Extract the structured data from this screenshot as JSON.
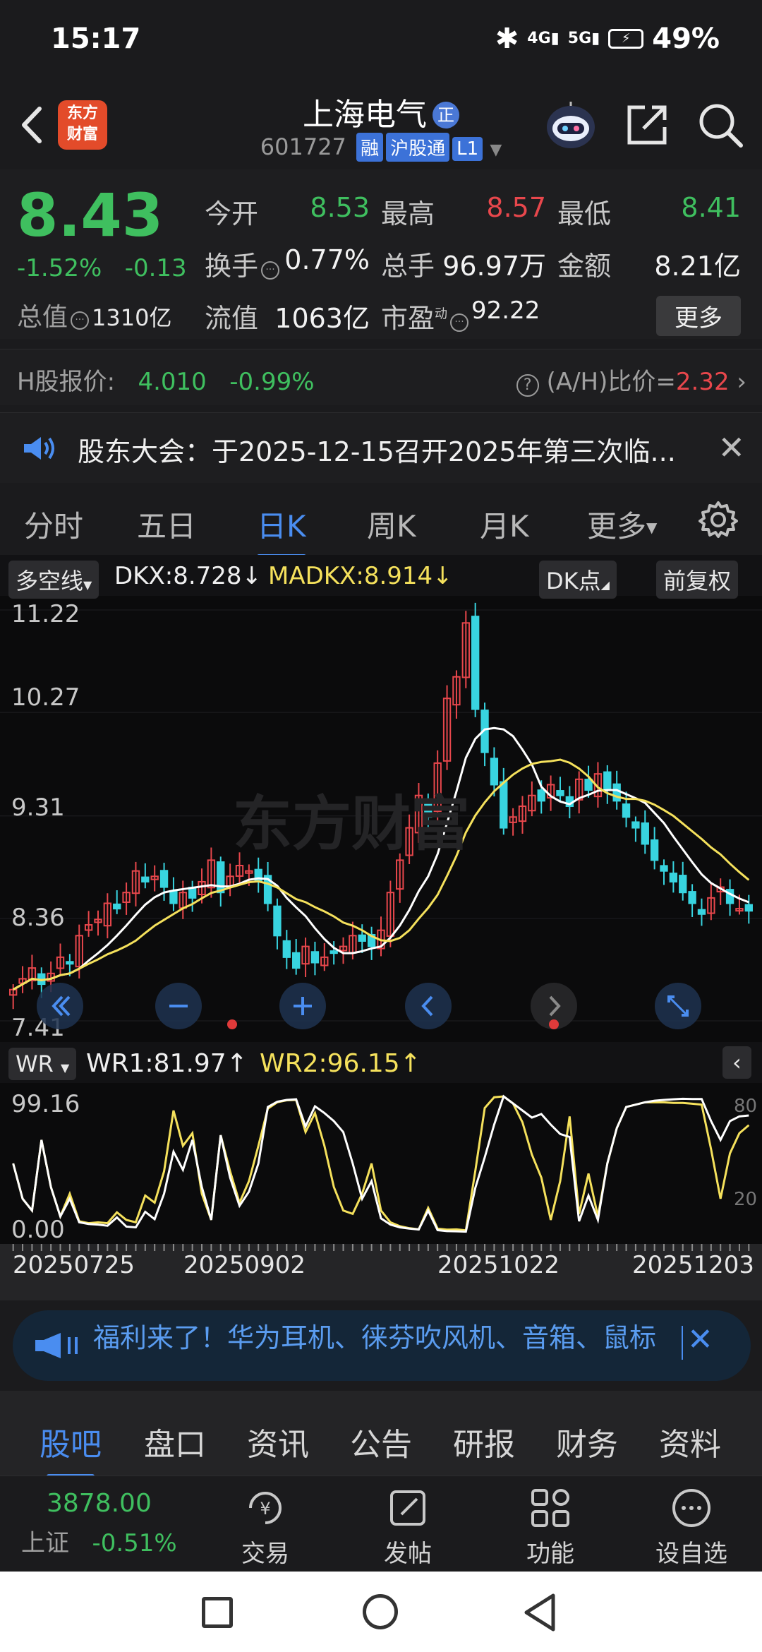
{
  "status": {
    "time": "15:17",
    "net1": "4G",
    "net2": "5G",
    "battery": "49%"
  },
  "header": {
    "brand_line1": "东方",
    "brand_line2": "财富",
    "stock_name": "上海电气",
    "badge": "正",
    "stock_code": "601727",
    "tags": [
      "融",
      "沪股通",
      "L1"
    ]
  },
  "quote": {
    "price": "8.43",
    "change_pct": "-1.52%",
    "change": "-0.13",
    "rows": [
      [
        {
          "label": "今开",
          "value": "8.53",
          "color": "green"
        },
        {
          "label": "最高",
          "value": "8.57",
          "color": "red"
        },
        {
          "label": "最低",
          "value": "8.41",
          "color": "green"
        }
      ],
      [
        {
          "label": "换手",
          "value": "0.77%",
          "color": "white"
        },
        {
          "label": "总手",
          "value": "96.97万",
          "color": "white"
        },
        {
          "label": "金额",
          "value": "8.21亿",
          "color": "white"
        }
      ]
    ],
    "total_value_label": "总值",
    "total_value": "1310亿",
    "float_value_label": "流值",
    "float_value": "1063亿",
    "pe_label": "市盈",
    "pe_sup": "动",
    "pe_value": "92.22",
    "more_label": "更多"
  },
  "hshare": {
    "label": "H股报价:",
    "price": "4.010",
    "change": "-0.99%",
    "ratio_label": "(A/H)比价=",
    "ratio": "2.32"
  },
  "notice": {
    "text": "股东大会：于2025-12-15召开2025年第三次临..."
  },
  "period_tabs": [
    "分时",
    "五日",
    "日K",
    "周K",
    "月K",
    "更多"
  ],
  "kline": {
    "indicator": "多空线",
    "dkx": "DKX:8.728",
    "madkx": "MADKX:8.914",
    "dk_label": "DK点",
    "adjust_label": "前复权",
    "watermark": "东方财富",
    "yticks": [
      "11.22",
      "10.27",
      "9.31",
      "8.36",
      "7.41"
    ]
  },
  "wr": {
    "indicator": "WR",
    "wr1": "WR1:81.97",
    "wr2": "WR2:96.15",
    "top": "99.16",
    "bottom": "0.00",
    "r80": "80",
    "r20": "20"
  },
  "dates": [
    "20250725",
    "20250902",
    "20251022",
    "20251203"
  ],
  "chart_data": [
    {
      "type": "candlestick",
      "title": "",
      "xlabel": "",
      "ylabel": "",
      "ylim": [
        7.41,
        11.22
      ],
      "x_ticks": [
        "20250725",
        "20250902",
        "20251022",
        "20251203"
      ],
      "series": [
        {
          "name": "DKX",
          "last": 8.728,
          "color": "#ffffff"
        },
        {
          "name": "MADKX",
          "last": 8.914,
          "color": "#f5e15c"
        }
      ],
      "candles_close": [
        7.7,
        7.8,
        7.9,
        7.75,
        7.85,
        8.0,
        7.95,
        8.2,
        8.3,
        8.35,
        8.5,
        8.45,
        8.6,
        8.8,
        8.7,
        8.75,
        8.65,
        8.5,
        8.6,
        8.55,
        8.7,
        8.9,
        8.6,
        8.75,
        8.85,
        8.8,
        8.7,
        8.5,
        8.2,
        8.0,
        7.9,
        8.1,
        7.95,
        8.0,
        8.05,
        8.1,
        8.2,
        8.15,
        8.1,
        8.25,
        8.6,
        8.9,
        9.2,
        9.5,
        9.3,
        9.8,
        10.4,
        10.6,
        11.1,
        10.3,
        9.9,
        9.6,
        9.2,
        9.3,
        9.4,
        9.5,
        9.45,
        9.6,
        9.5,
        9.4,
        9.65,
        9.55,
        9.7,
        9.55,
        9.45,
        9.3,
        9.2,
        9.05,
        8.9,
        8.8,
        8.7,
        8.6,
        8.5,
        8.4,
        8.55,
        8.65,
        8.5,
        8.45,
        8.43
      ]
    },
    {
      "type": "line",
      "title": "",
      "ylim": [
        0,
        99.16
      ],
      "series": [
        {
          "name": "WR1",
          "last": 81.97,
          "color": "#ffffff"
        },
        {
          "name": "WR2",
          "last": 96.15,
          "color": "#f5e15c"
        }
      ]
    }
  ],
  "promo": {
    "text": "福利来了！华为耳机、徕芬吹风机、音箱、鼠标"
  },
  "bottom_tabs": [
    "股吧",
    "盘口",
    "资讯",
    "公告",
    "研报",
    "财务",
    "资料"
  ],
  "index": {
    "value": "3878.00",
    "name": "上证",
    "change": "-0.51%"
  },
  "actions": [
    "交易",
    "发帖",
    "功能",
    "设自选"
  ],
  "colors": {
    "up": "#e8474c",
    "down": "#3fbf5f",
    "accent": "#4a8df0",
    "cyan": "#38d4e0"
  }
}
